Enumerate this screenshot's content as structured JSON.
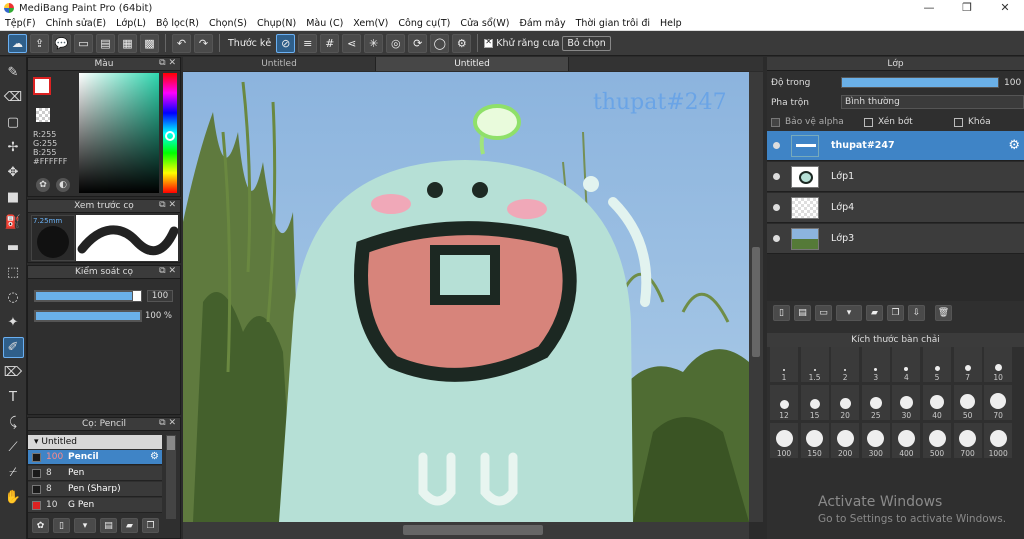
{
  "window": {
    "title": "MediBang Paint Pro (64bit)",
    "min": "—",
    "max": "❐",
    "close": "✕"
  },
  "menu": [
    "Tệp(F)",
    "Chỉnh sửa(E)",
    "Lớp(L)",
    "Bộ lọc(R)",
    "Chọn(S)",
    "Chụp(N)",
    "Màu (C)",
    "Xem(V)",
    "Công cụ(T)",
    "Cửa sổ(W)",
    "Đám mây",
    "Thời gian trôi đi",
    "Help"
  ],
  "toolbar": {
    "ruler_label": "Thước kẻ",
    "antialias_label": "Khử răng cưa",
    "deselect_label": "Bỏ chọn",
    "antialias_checked": true
  },
  "color_panel": {
    "title": "Màu",
    "r": "R:255",
    "g": "G:255",
    "b": "B:255",
    "hex": "#FFFFFF"
  },
  "brush_preview": {
    "title": "Xem trước cọ",
    "size": "7.25mm"
  },
  "brush_control": {
    "title": "Kiểm soát cọ",
    "size_value": "100",
    "opacity_value": "100 %",
    "size_fraction": 1.0,
    "opacity_fraction": 1.0
  },
  "brush_list": {
    "title": "Cọ: Pencil",
    "group": "Untitled",
    "items": [
      {
        "size": "100",
        "name": "Pencil",
        "selected": true,
        "color": "#1a1a1a"
      },
      {
        "size": "8",
        "name": "Pen",
        "selected": false,
        "color": "#1a1a1a"
      },
      {
        "size": "8",
        "name": "Pen (Sharp)",
        "selected": false,
        "color": "#1a1a1a"
      },
      {
        "size": "10",
        "name": "G Pen",
        "selected": false,
        "color": "#d22"
      }
    ]
  },
  "tabs": [
    "Untitled",
    "Untitled"
  ],
  "canvas": {
    "watermark": "thupat#247"
  },
  "layers_panel": {
    "title": "Lớp",
    "opacity_label": "Độ trong",
    "opacity_value": "100 %",
    "blend_label": "Pha trộn",
    "blend_value": "Bình thường",
    "protect_alpha": "Bảo vệ alpha",
    "clipping": "Xén bớt",
    "lock": "Khóa",
    "layers": [
      {
        "name": "thupat#247",
        "selected": true
      },
      {
        "name": "Lớp1",
        "selected": false
      },
      {
        "name": "Lớp4",
        "selected": false
      },
      {
        "name": "Lớp3",
        "selected": false
      }
    ]
  },
  "brush_size_panel": {
    "title": "Kích thước bàn chải",
    "sizes": [
      "1",
      "1.5",
      "2",
      "3",
      "4",
      "5",
      "7",
      "10",
      "12",
      "15",
      "20",
      "25",
      "30",
      "40",
      "50",
      "70",
      "100",
      "150",
      "200",
      "300",
      "400",
      "500",
      "700",
      "1000"
    ]
  },
  "watermark": {
    "line1": "Activate Windows",
    "line2": "Go to Settings to activate Windows."
  },
  "colors": {
    "accent": "#3f84c6",
    "panel": "#2f2f2f",
    "character": "#b6e0d6"
  }
}
